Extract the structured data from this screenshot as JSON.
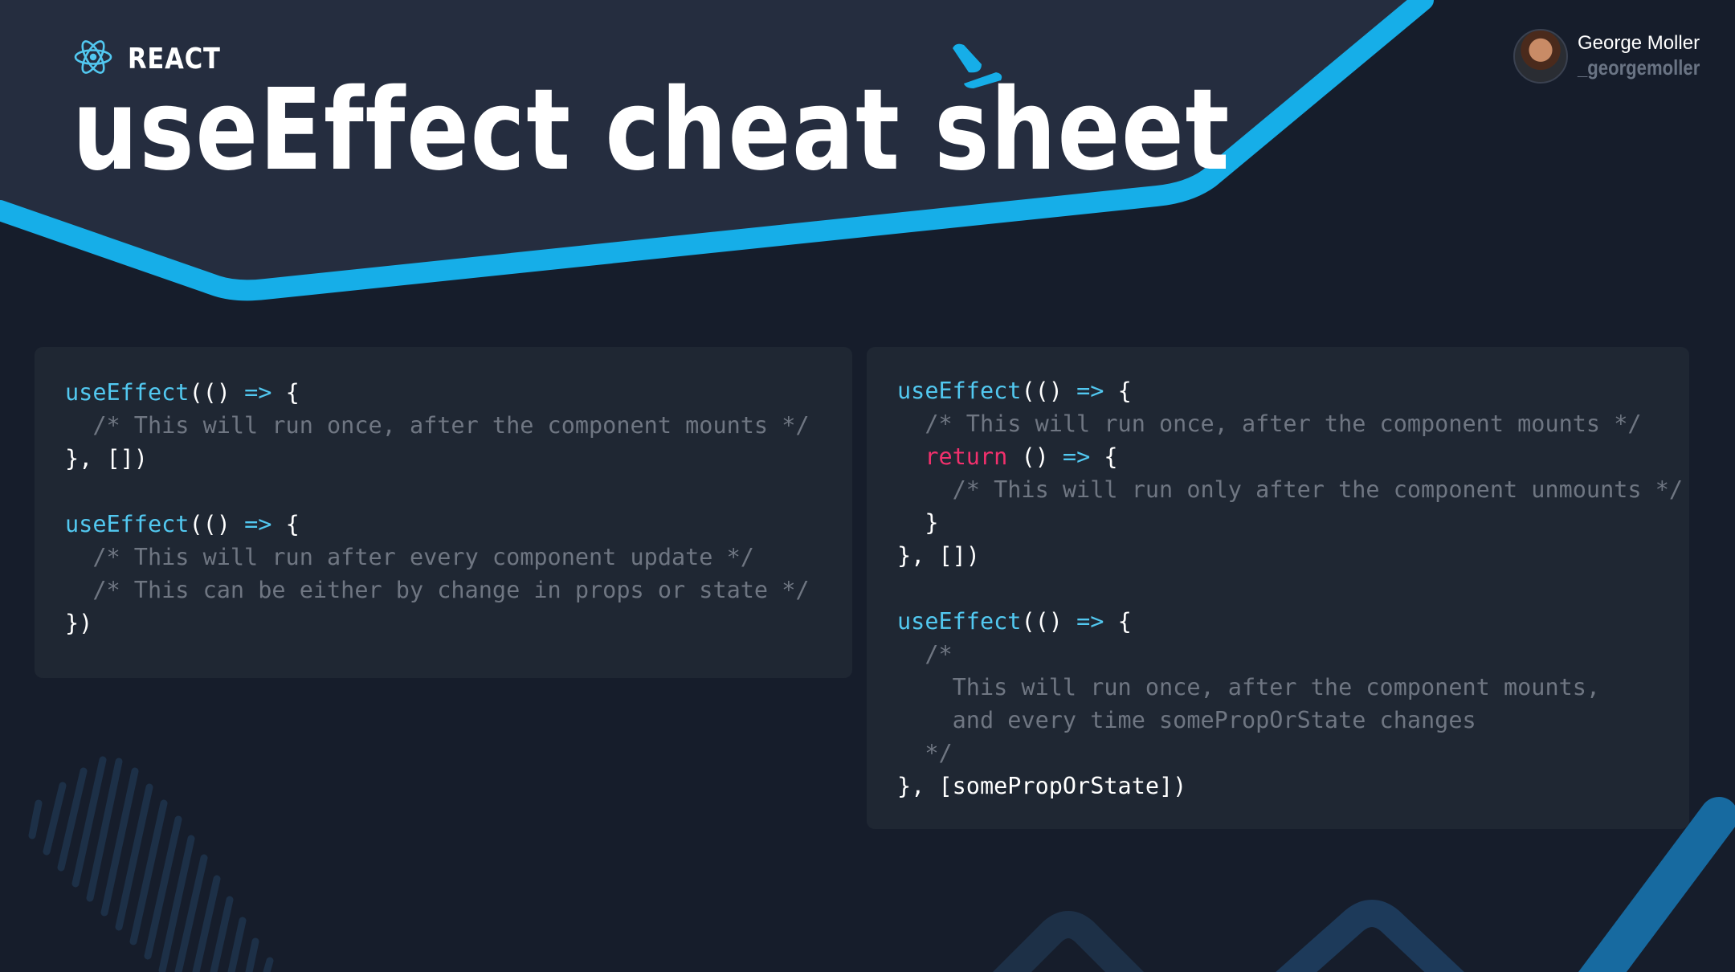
{
  "header": {
    "brand_label": "REACT",
    "title": "useEffect cheat sheet"
  },
  "author": {
    "name": "George Moller",
    "handle": "_georgemoller"
  },
  "colors": {
    "background": "#161d2b",
    "header_band": "#252d3f",
    "accent_blue": "#16aee8",
    "code_panel": "#1f2733",
    "function": "#52c8f0",
    "keyword": "#f2306d",
    "comment": "#6f7682"
  },
  "icons": [
    "react-logo-icon",
    "avatar"
  ],
  "panels": {
    "left": {
      "lines": [
        [
          {
            "t": "useEffect",
            "c": "fn"
          },
          {
            "t": "(() ",
            "c": "pn"
          },
          {
            "t": "=>",
            "c": "op"
          },
          {
            "t": " {",
            "c": "pn"
          }
        ],
        [
          {
            "t": "  /* This will run once, after the component mounts */",
            "c": "cm"
          }
        ],
        [
          {
            "t": "}, [])",
            "c": "pn"
          }
        ],
        [],
        [
          {
            "t": "useEffect",
            "c": "fn"
          },
          {
            "t": "(() ",
            "c": "pn"
          },
          {
            "t": "=>",
            "c": "op"
          },
          {
            "t": " {",
            "c": "pn"
          }
        ],
        [
          {
            "t": "  /* This will run after every component update */",
            "c": "cm"
          }
        ],
        [
          {
            "t": "  /* This can be either by change in props or state */",
            "c": "cm"
          }
        ],
        [
          {
            "t": "})",
            "c": "pn"
          }
        ]
      ]
    },
    "right": {
      "lines": [
        [
          {
            "t": "useEffect",
            "c": "fn"
          },
          {
            "t": "(() ",
            "c": "pn"
          },
          {
            "t": "=>",
            "c": "op"
          },
          {
            "t": " {",
            "c": "pn"
          }
        ],
        [
          {
            "t": "  /* This will run once, after the component mounts */",
            "c": "cm"
          }
        ],
        [
          {
            "t": "  ",
            "c": "pn"
          },
          {
            "t": "return",
            "c": "kw"
          },
          {
            "t": " () ",
            "c": "pn"
          },
          {
            "t": "=>",
            "c": "op"
          },
          {
            "t": " {",
            "c": "pn"
          }
        ],
        [
          {
            "t": "    /* This will run only after the component unmounts */",
            "c": "cm"
          }
        ],
        [
          {
            "t": "  }",
            "c": "pn"
          }
        ],
        [
          {
            "t": "}, [])",
            "c": "pn"
          }
        ],
        [],
        [
          {
            "t": "useEffect",
            "c": "fn"
          },
          {
            "t": "(() ",
            "c": "pn"
          },
          {
            "t": "=>",
            "c": "op"
          },
          {
            "t": " {",
            "c": "pn"
          }
        ],
        [
          {
            "t": "  /*",
            "c": "cm"
          }
        ],
        [
          {
            "t": "    This will run once, after the component mounts,",
            "c": "cm"
          }
        ],
        [
          {
            "t": "    and every time somePropOrState changes",
            "c": "cm"
          }
        ],
        [
          {
            "t": "  */",
            "c": "cm"
          }
        ],
        [
          {
            "t": "}, [somePropOrState])",
            "c": "pn"
          }
        ]
      ]
    }
  }
}
